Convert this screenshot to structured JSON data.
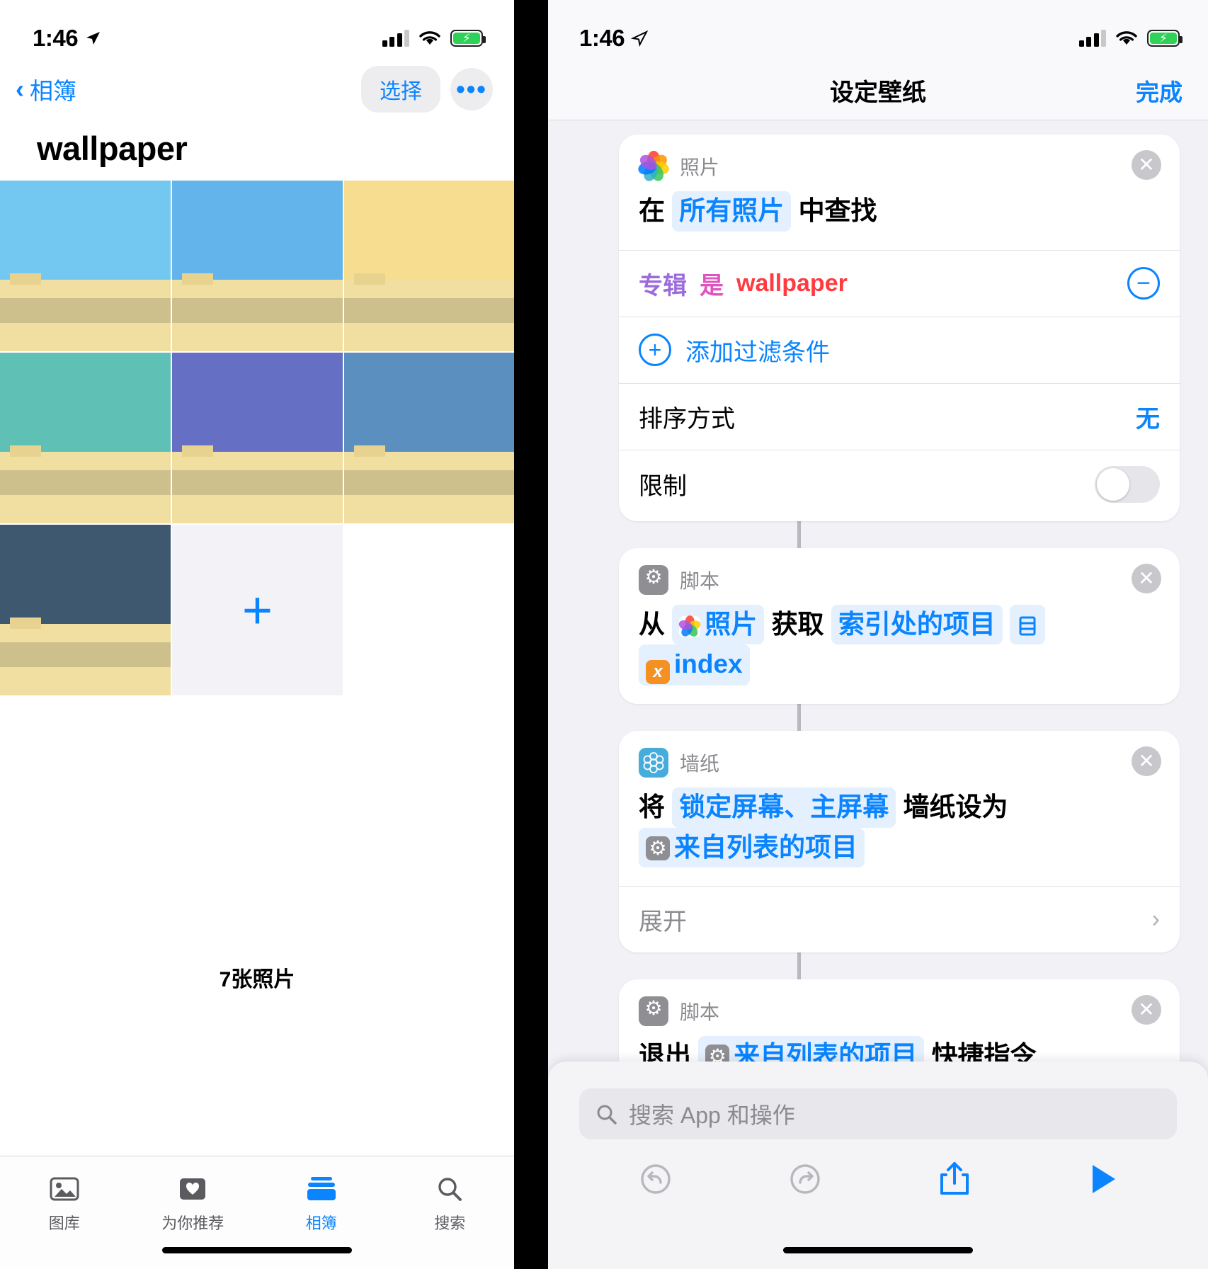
{
  "left": {
    "status": {
      "time": "1:46",
      "location_icon": "location-arrow-icon",
      "signal_icon": "cellular-signal-icon",
      "wifi_icon": "wifi-icon",
      "battery_icon": "battery-charging-icon"
    },
    "nav": {
      "back_label": "相簿",
      "select_label": "选择",
      "more_label": "•••"
    },
    "title": "wallpaper",
    "photos": [
      {
        "name": "photo-1",
        "sky": "#73c8f2"
      },
      {
        "name": "photo-2",
        "sky": "#62b4ea"
      },
      {
        "name": "photo-3",
        "sky": "#f6dd8f"
      },
      {
        "name": "photo-4",
        "sky": "#5fc0b6"
      },
      {
        "name": "photo-5",
        "sky": "#6570c4"
      },
      {
        "name": "photo-6",
        "sky": "#5a8fc0"
      },
      {
        "name": "photo-7",
        "sky": "#3e5870"
      }
    ],
    "add_label": "+",
    "count_label": "7张照片",
    "tabs": [
      {
        "label": "图库",
        "icon": "photos-library-icon",
        "active": false
      },
      {
        "label": "为你推荐",
        "icon": "for-you-heart-icon",
        "active": false
      },
      {
        "label": "相簿",
        "icon": "albums-icon",
        "active": true
      },
      {
        "label": "搜索",
        "icon": "search-icon",
        "active": false
      }
    ]
  },
  "right": {
    "status": {
      "time": "1:46",
      "location_icon": "location-arrow-icon",
      "signal_icon": "cellular-signal-icon",
      "wifi_icon": "wifi-icon",
      "battery_icon": "battery-charging-icon"
    },
    "nav": {
      "title": "设定壁纸",
      "done_label": "完成"
    },
    "actions": [
      {
        "app": "照片",
        "app_icon": "photos-app-icon",
        "close_icon": "close-icon",
        "body": {
          "pre": "在",
          "token": "所有照片",
          "post": "中查找"
        },
        "filter": {
          "field": "专辑",
          "operator": "是",
          "value": "wallpaper",
          "remove_icon": "minus-circle-icon"
        },
        "add_filter": {
          "icon": "plus-circle-icon",
          "label": "添加过滤条件"
        },
        "sort": {
          "label": "排序方式",
          "value": "无"
        },
        "limit": {
          "label": "限制",
          "toggle": "off"
        }
      },
      {
        "app": "脚本",
        "app_icon": "scripting-gear-icon",
        "close_icon": "close-icon",
        "body_parts": [
          "从",
          "照片",
          "获取",
          "索引处的项目",
          "index"
        ]
      },
      {
        "app": "墙纸",
        "app_icon": "wallpaper-icon",
        "close_icon": "close-icon",
        "body_parts": [
          "将",
          "锁定屏幕、主屏幕",
          "墙纸设为",
          "来自列表的项目"
        ],
        "expand": {
          "label": "展开",
          "chevron": "chevron-right-icon"
        }
      },
      {
        "app": "脚本",
        "app_icon": "scripting-gear-icon",
        "close_icon": "close-icon",
        "body_parts": [
          "退出",
          "来自列表的项目",
          "快捷指令"
        ]
      }
    ],
    "search": {
      "placeholder": "搜索 App 和操作",
      "icon": "search-icon"
    },
    "toolbar": [
      {
        "name": "undo-button",
        "icon": "undo-icon"
      },
      {
        "name": "redo-button",
        "icon": "redo-icon"
      },
      {
        "name": "share-button",
        "icon": "share-icon"
      },
      {
        "name": "run-button",
        "icon": "play-icon"
      }
    ]
  }
}
